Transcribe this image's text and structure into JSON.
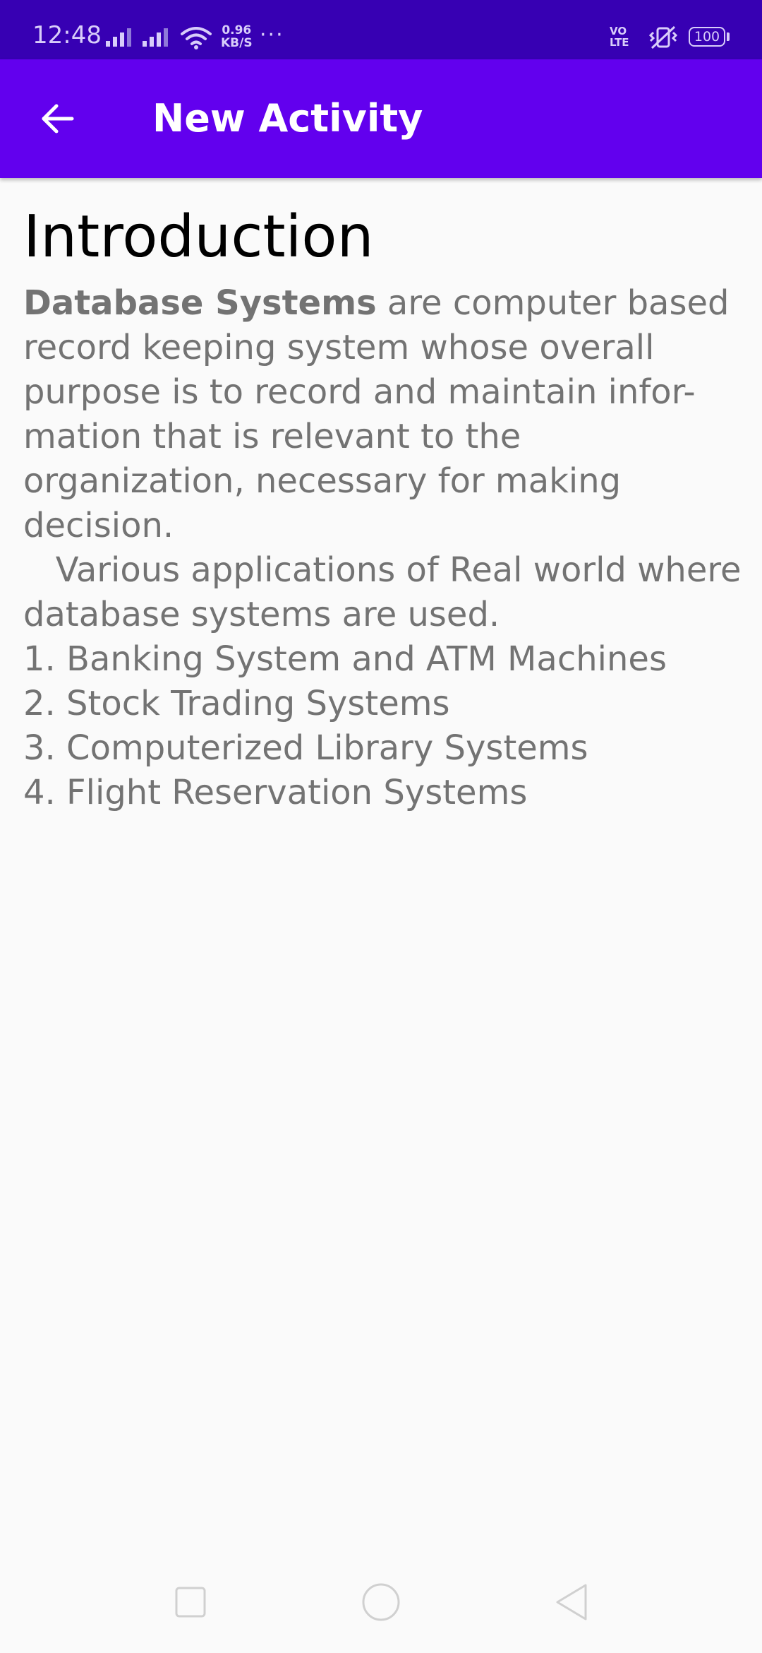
{
  "status_bar": {
    "time": "12:48",
    "net_speed_value": "0.96",
    "net_speed_unit": "KB/S",
    "more": "···",
    "volte_top": "VO",
    "volte_bottom": "LTE",
    "battery": "100",
    "icons": [
      "signal-icon",
      "signal-icon",
      "wifi-icon",
      "volte-icon",
      "vibrate-icon",
      "battery-icon"
    ]
  },
  "app_bar": {
    "title": "New Activity",
    "back_icon": "arrow-back-icon",
    "color": "#6200ee",
    "status_color": "#3700b3"
  },
  "content": {
    "heading": "Introduction",
    "intro_bold": "Database Systems",
    "intro_rest": " are computer based record keeping system whose overall purpose is to record and maintain infor-mation that is relevant to the organization, necessary for making decision.",
    "applications_intro": "   Various applications of Real world where database systems are used.",
    "list": [
      "1. Banking System and ATM Machines",
      "2. Stock Trading Systems",
      "3. Computerized Library Systems",
      "4. Flight Reservation Systems"
    ]
  },
  "nav_bar": {
    "icons": [
      "recents-icon",
      "home-icon",
      "back-icon"
    ]
  }
}
